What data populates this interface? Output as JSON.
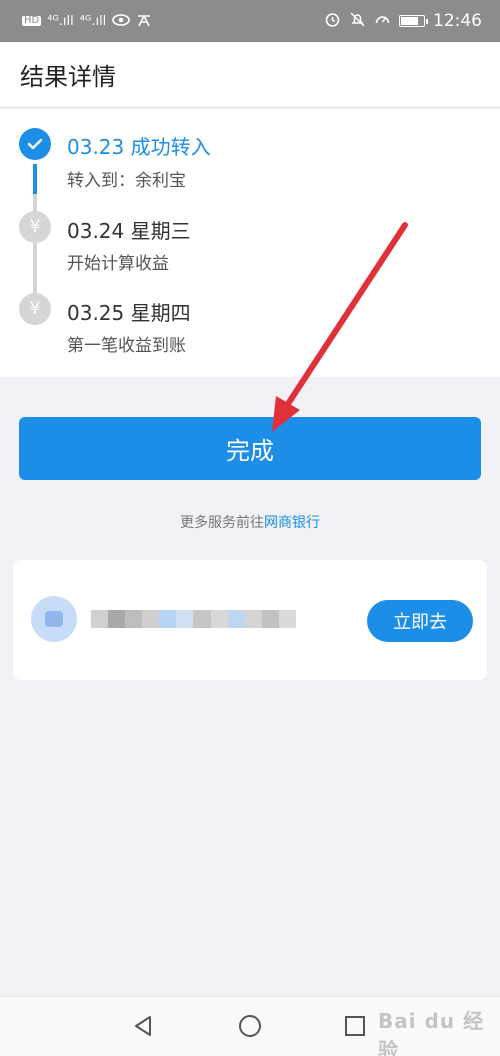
{
  "status_bar": {
    "left_icons": [
      "hd-icon",
      "signal-4g-icon",
      "signal-4g-icon",
      "eye-icon",
      "notification-icon"
    ],
    "left_labels": [
      "HD",
      "⁴ᴳ.ıll",
      "⁴ᴳ.ıll"
    ],
    "time": "12:46",
    "battery_level": 0.8
  },
  "header": {
    "title": "结果详情"
  },
  "timeline": {
    "steps": [
      {
        "title": "03.23 成功转入",
        "subtitle": "转入到：余利宝",
        "state": "done",
        "icon": "check-icon"
      },
      {
        "title": "03.24 星期三",
        "subtitle": "开始计算收益",
        "state": "pending",
        "icon": "yuan-icon"
      },
      {
        "title": "03.25 星期四",
        "subtitle": "第一笔收益到账",
        "state": "pending",
        "icon": "yuan-icon"
      }
    ]
  },
  "done_button": {
    "label": "完成"
  },
  "more_services": {
    "prefix": "更多服务前往",
    "bank": "网商银行"
  },
  "promo": {
    "button_label": "立即去"
  },
  "colors": {
    "accent": "#1c8ee8",
    "arrow": "#e0303a",
    "status_bar": "#8c8c8c"
  },
  "nav_bar": {
    "icons": [
      "back-icon",
      "home-icon",
      "recent-apps-icon"
    ]
  },
  "watermark": "Bai du 经验"
}
